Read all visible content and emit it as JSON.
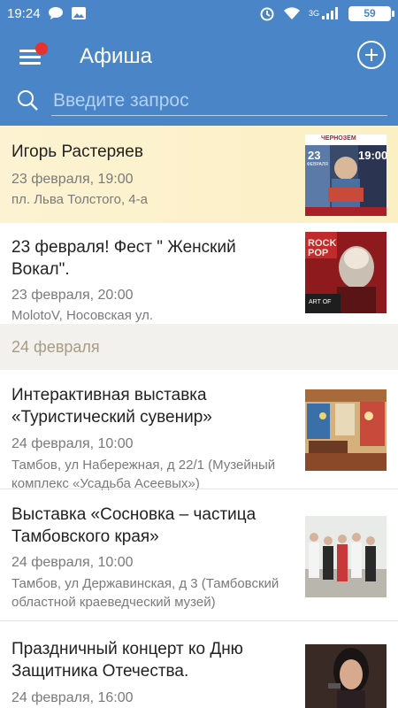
{
  "status_bar": {
    "time": "19:24",
    "network": "3G",
    "battery": "59",
    "icons": [
      "chat-icon",
      "gallery-icon",
      "alarm-icon",
      "wifi-icon",
      "signal-icon",
      "battery-icon"
    ]
  },
  "header": {
    "title": "Афиша",
    "search_placeholder": "Введите запрос",
    "accent_color": "#4a86c7",
    "notification_color": "#e8302c"
  },
  "events_top": [
    {
      "title": "Игорь Растеряев",
      "date": "23 февраля, 19:00",
      "place": "пл. Льва Толстого, 4-а",
      "highlighted": true,
      "poster": {
        "brand": "ЧЕРНОЗЁМ",
        "day": "23",
        "month": "ФЕВРАЛЯ",
        "time": "19:00"
      }
    },
    {
      "title": "23 февраля! Фест \" Женский Вокал\".",
      "date": "23 февраля, 20:00",
      "place": "MolotoV, Носовская ул.",
      "highlighted": false,
      "poster": {
        "top_text": "ROCK POP",
        "bottom_text": "ART OF"
      }
    }
  ],
  "section": {
    "label": "24 февраля"
  },
  "events_bottom": [
    {
      "title": "Интерактивная выставка «Туристический сувенир»",
      "date": "24 февраля, 10:00",
      "place": "Тамбов, ул Набережная, д 22/1 (Музейный комплекс «Усадьба Асеевых»)"
    },
    {
      "title": "Выставка «Сосновка – частица Тамбовского края»",
      "date": "24 февраля, 10:00",
      "place": "Тамбов, ул Державинская, д 3 (Тамбовский областной краеведческий музей)"
    },
    {
      "title": "Праздничный концерт ко Дню Защитника Отечества.",
      "date": "24 февраля, 16:00",
      "place": ""
    }
  ]
}
